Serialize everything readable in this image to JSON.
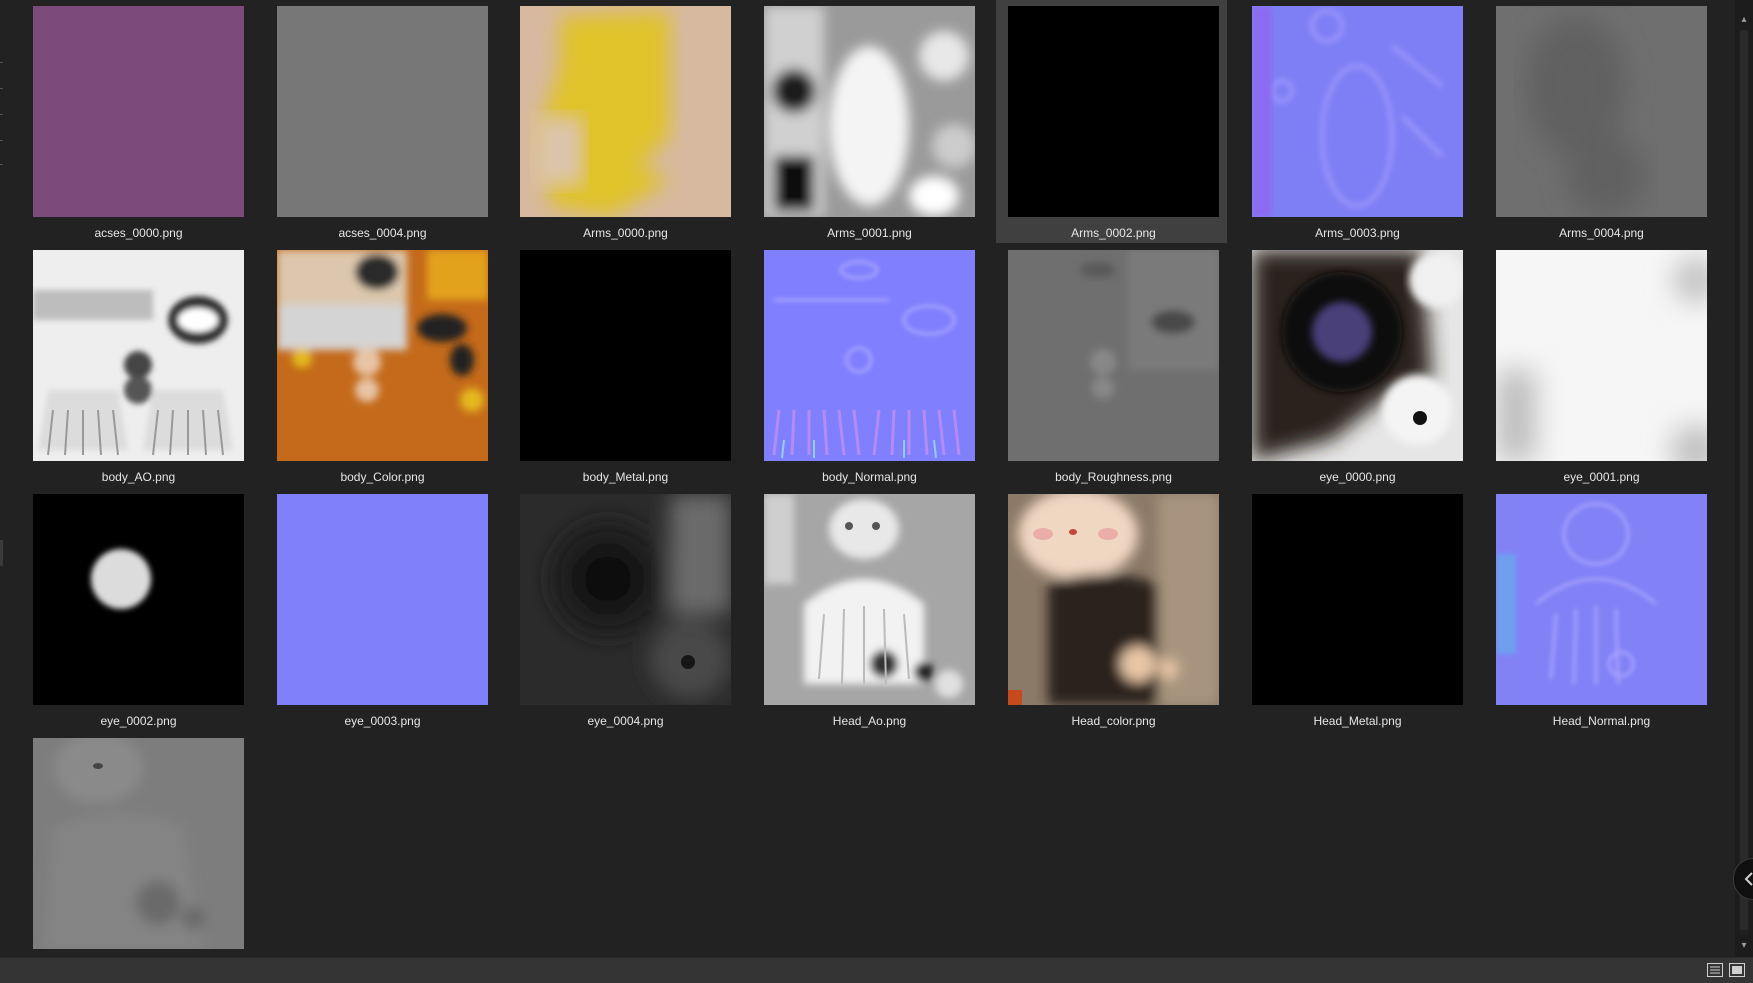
{
  "colors": {
    "background": "#222222",
    "selection": "#404040",
    "label": "#e6e6e6",
    "statusbar": "#343434"
  },
  "files": [
    {
      "name": "acses_0000.png",
      "icon": "texture-thumbnail",
      "selected": false
    },
    {
      "name": "acses_0004.png",
      "icon": "texture-thumbnail",
      "selected": false
    },
    {
      "name": "Arms_0000.png",
      "icon": "texture-thumbnail",
      "selected": false
    },
    {
      "name": "Arms_0001.png",
      "icon": "texture-thumbnail",
      "selected": false
    },
    {
      "name": "Arms_0002.png",
      "icon": "texture-thumbnail",
      "selected": true
    },
    {
      "name": "Arms_0003.png",
      "icon": "texture-thumbnail",
      "selected": false
    },
    {
      "name": "Arms_0004.png",
      "icon": "texture-thumbnail",
      "selected": false
    },
    {
      "name": "body_AO.png",
      "icon": "texture-thumbnail",
      "selected": false
    },
    {
      "name": "body_Color.png",
      "icon": "texture-thumbnail",
      "selected": false
    },
    {
      "name": "body_Metal.png",
      "icon": "texture-thumbnail",
      "selected": false
    },
    {
      "name": "body_Normal.png",
      "icon": "texture-thumbnail",
      "selected": false
    },
    {
      "name": "body_Roughness.png",
      "icon": "texture-thumbnail",
      "selected": false
    },
    {
      "name": "eye_0000.png",
      "icon": "texture-thumbnail",
      "selected": false
    },
    {
      "name": "eye_0001.png",
      "icon": "texture-thumbnail",
      "selected": false
    },
    {
      "name": "eye_0002.png",
      "icon": "texture-thumbnail",
      "selected": false
    },
    {
      "name": "eye_0003.png",
      "icon": "texture-thumbnail",
      "selected": false
    },
    {
      "name": "eye_0004.png",
      "icon": "texture-thumbnail",
      "selected": false
    },
    {
      "name": "Head_Ao.png",
      "icon": "texture-thumbnail",
      "selected": false
    },
    {
      "name": "Head_color.png",
      "icon": "texture-thumbnail",
      "selected": false
    },
    {
      "name": "Head_Metal.png",
      "icon": "texture-thumbnail",
      "selected": false
    },
    {
      "name": "Head_Normal.png",
      "icon": "texture-thumbnail",
      "selected": false
    },
    {
      "name": "",
      "icon": "texture-thumbnail",
      "selected": false
    }
  ],
  "statusbar": {
    "list_view_icon": "list-view-icon",
    "thumbnail_view_icon": "thumbnail-view-icon"
  },
  "scrollbar": {
    "up_icon": "chevron-up-icon",
    "down_icon": "chevron-down-icon"
  },
  "collapse_icon": "chevron-left-icon"
}
